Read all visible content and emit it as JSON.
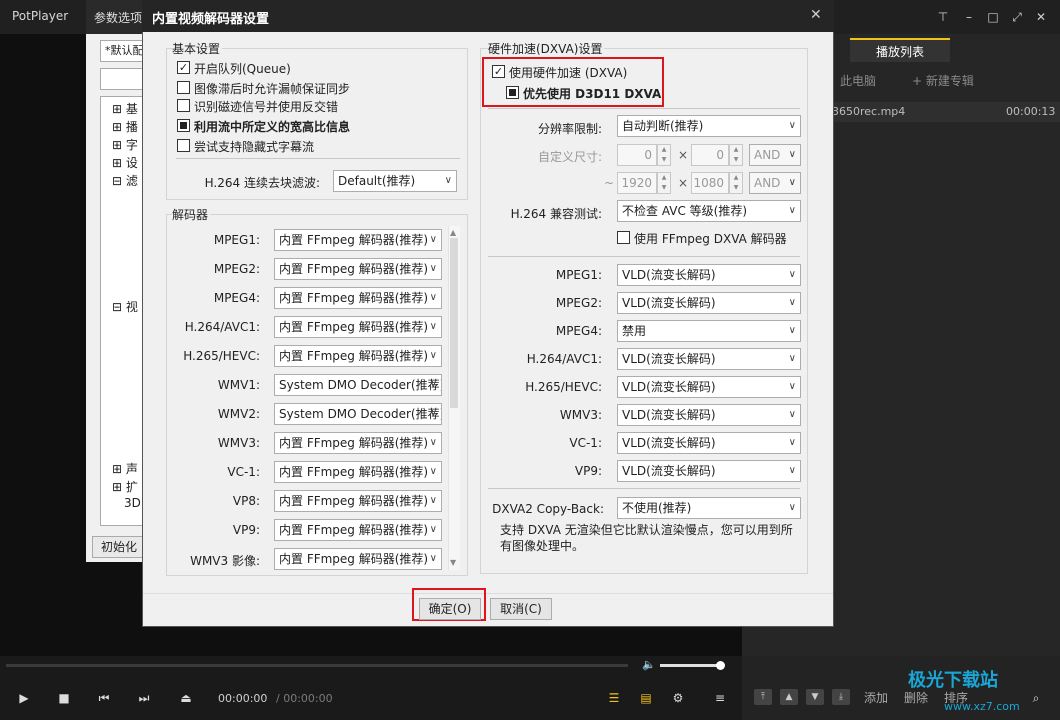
{
  "app": {
    "title": "PotPlayer",
    "window_buttons": [
      "pin-icon",
      "minimize-icon",
      "maximize-icon",
      "close-icon"
    ]
  },
  "playlist": {
    "active_tab": "播放列表",
    "this_pc": "此电脑",
    "new_album": "+ 新建专辑",
    "item_name": "3650rec.mp4",
    "item_time": "00:00:13",
    "add": "添加",
    "delete": "删除",
    "sort": "排序"
  },
  "player": {
    "time_current": "00:00:00",
    "time_total": "/ 00:00:00"
  },
  "preferences": {
    "title": "参数选项",
    "profile": "*默认配",
    "tree": [
      "基",
      "播",
      "字",
      "设",
      "滤",
      "视",
      "声",
      "扩",
      "3D"
    ],
    "reset_button": "初始化"
  },
  "dialog": {
    "title": "内置视频解码器设置",
    "basic": {
      "label": "基本设置",
      "options": [
        {
          "label": "开启队列(Queue)",
          "checked": true,
          "bold": false
        },
        {
          "label": "图像滞后时允许漏帧保证同步",
          "checked": false,
          "bold": false
        },
        {
          "label": "识别磁迹信号并使用反交错",
          "checked": false,
          "bold": false
        },
        {
          "label": "利用流中所定义的宽高比信息",
          "checked": true,
          "bold": true,
          "filled": true
        },
        {
          "label": "尝试支持隐藏式字幕流",
          "checked": false,
          "bold": false
        }
      ],
      "deblock_label": "H.264 连续去块滤波:",
      "deblock_value": "Default(推荐)"
    },
    "decoders": {
      "label": "解码器",
      "rows": [
        {
          "name": "MPEG1:",
          "value": "内置 FFmpeg 解码器(推荐)"
        },
        {
          "name": "MPEG2:",
          "value": "内置 FFmpeg 解码器(推荐)"
        },
        {
          "name": "MPEG4:",
          "value": "内置 FFmpeg 解码器(推荐)"
        },
        {
          "name": "H.264/AVC1:",
          "value": "内置 FFmpeg 解码器(推荐)"
        },
        {
          "name": "H.265/HEVC:",
          "value": "内置 FFmpeg 解码器(推荐)"
        },
        {
          "name": "WMV1:",
          "value": "System DMO Decoder(推荐)"
        },
        {
          "name": "WMV2:",
          "value": "System DMO Decoder(推荐)"
        },
        {
          "name": "WMV3:",
          "value": "内置 FFmpeg 解码器(推荐)"
        },
        {
          "name": "VC-1:",
          "value": "内置 FFmpeg 解码器(推荐)"
        },
        {
          "name": "VP8:",
          "value": "内置 FFmpeg 解码器(推荐)"
        },
        {
          "name": "VP9:",
          "value": "内置 FFmpeg 解码器(推荐)"
        },
        {
          "name": "WMV3 影像:",
          "value": "内置 FFmpeg 解码器(推荐)"
        }
      ]
    },
    "hw": {
      "label": "硬件加速(DXVA)设置",
      "use_hw": "使用硬件加速 (DXVA)",
      "prefer_d3d11": "优先使用 D3D11 DXVA",
      "resolution_label": "分辨率限制:",
      "resolution_value": "自动判断(推荐)",
      "custom_size_label": "自定义尺寸:",
      "min_w": "0",
      "min_h": "0",
      "max_w": "1920",
      "max_h": "1080",
      "and": "AND",
      "times": "×",
      "tilde": "~",
      "h264_compat_label": "H.264 兼容测试:",
      "h264_compat_value": "不检查 AVC 等级(推荐)",
      "ffmpeg_dxva": "使用 FFmpeg DXVA 解码器",
      "codec_rows": [
        {
          "name": "MPEG1:",
          "value": "VLD(流变长解码)"
        },
        {
          "name": "MPEG2:",
          "value": "VLD(流变长解码)"
        },
        {
          "name": "MPEG4:",
          "value": "禁用"
        },
        {
          "name": "H.264/AVC1:",
          "value": "VLD(流变长解码)"
        },
        {
          "name": "H.265/HEVC:",
          "value": "VLD(流变长解码)"
        },
        {
          "name": "WMV3:",
          "value": "VLD(流变长解码)"
        },
        {
          "name": "VC-1:",
          "value": "VLD(流变长解码)"
        },
        {
          "name": "VP9:",
          "value": "VLD(流变长解码)"
        }
      ],
      "copyback_label": "DXVA2 Copy-Back:",
      "copyback_value": "不使用(推荐)",
      "description": "支持 DXVA 无渲染但它比默认渲染慢点，您可以用到所有图像处理中。"
    },
    "ok": "确定(O)",
    "cancel": "取消(C)"
  },
  "colors": {
    "highlight": "#e0151b",
    "accent": "#f2c21a"
  }
}
